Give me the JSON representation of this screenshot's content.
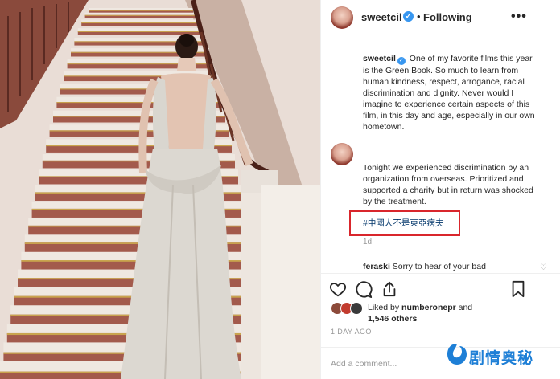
{
  "header": {
    "username": "sweetcil",
    "separator": "•",
    "follow_status": "Following",
    "more_glyph": "•••"
  },
  "caption": {
    "username": "sweetcil",
    "text_1": " One of my favorite films this year is the Green Book. So much to learn from human kindness, respect, arrogance, racial discrimination and dignity. Never would I imagine to experience certain aspects of this film, in this day and age, especially in our own hometown.",
    "text_2": "Tonight we experienced discrimination by an organization from overseas. Prioritized and supported a charity but in return was shocked by the treatment.",
    "hashtag": "#中國人不是東亞病夫",
    "time": "1d"
  },
  "comment": {
    "username": "feraski",
    "text": " Sorry to hear of your bad"
  },
  "likes": {
    "prefix": "Liked by ",
    "user": "numberonepr",
    "middle": " and",
    "count": "1,546 others"
  },
  "date": "1 DAY AGO",
  "add_comment_placeholder": "Add a comment...",
  "watermark": "剧情奥秘",
  "colors": {
    "verified": "#3897f0",
    "highlight_box": "#d9262c",
    "watermark": "#1e7fd6"
  },
  "icons": [
    "heart-icon",
    "comment-icon",
    "share-icon",
    "bookmark-icon",
    "more-icon",
    "verified-badge-icon"
  ]
}
